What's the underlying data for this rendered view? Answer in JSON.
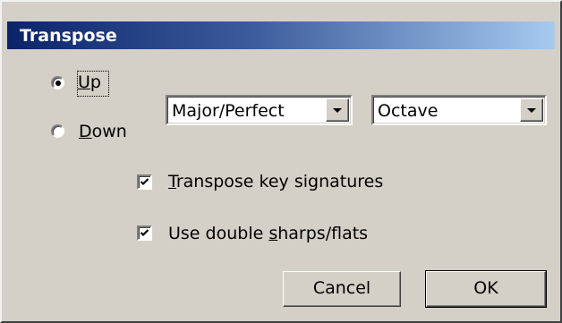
{
  "dialog": {
    "title": "Transpose"
  },
  "direction": {
    "up": {
      "prefix": "",
      "accel": "U",
      "suffix": "p",
      "selected": true
    },
    "down": {
      "prefix": "",
      "accel": "D",
      "suffix": "own",
      "selected": false
    }
  },
  "interval_quality": {
    "value": "Major/Perfect"
  },
  "interval": {
    "value": "Octave"
  },
  "options": {
    "transpose_key_signatures": {
      "prefix": "",
      "accel": "T",
      "suffix": "ranspose key signatures",
      "checked": true
    },
    "double_sharps_flats": {
      "prefix": "Use double ",
      "accel": "s",
      "suffix": "harps/flats",
      "checked": true
    }
  },
  "buttons": {
    "cancel": "Cancel",
    "ok": "OK"
  },
  "colors": {
    "face": "#d4d0c8",
    "title_start": "#0a246a",
    "title_end": "#a6caf0"
  }
}
